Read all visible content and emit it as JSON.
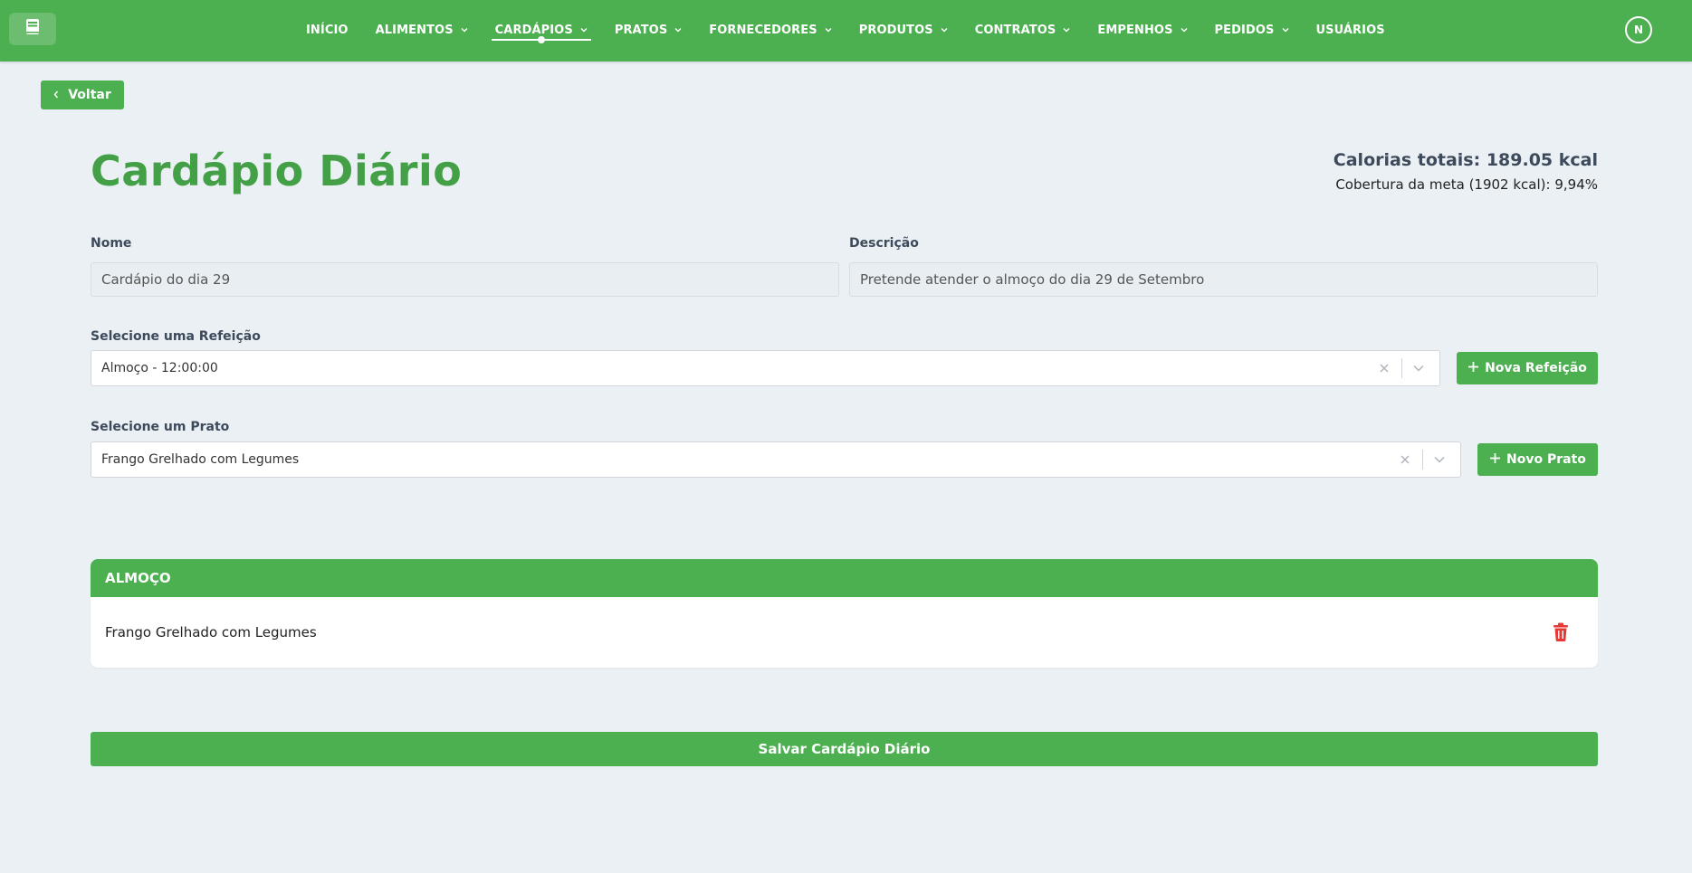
{
  "nav": {
    "items": [
      {
        "label": "INÍCIO",
        "dropdown": false,
        "active": false
      },
      {
        "label": "ALIMENTOS",
        "dropdown": true,
        "active": false
      },
      {
        "label": "CARDÁPIOS",
        "dropdown": true,
        "active": true
      },
      {
        "label": "PRATOS",
        "dropdown": true,
        "active": false
      },
      {
        "label": "FORNECEDORES",
        "dropdown": true,
        "active": false
      },
      {
        "label": "PRODUTOS",
        "dropdown": true,
        "active": false
      },
      {
        "label": "CONTRATOS",
        "dropdown": true,
        "active": false
      },
      {
        "label": "EMPENHOS",
        "dropdown": true,
        "active": false
      },
      {
        "label": "PEDIDOS",
        "dropdown": true,
        "active": false
      },
      {
        "label": "USUÁRIOS",
        "dropdown": false,
        "active": false
      }
    ],
    "avatar_initial": "N"
  },
  "back_label": "Voltar",
  "page": {
    "title": "Cardápio Diário",
    "calories_total": "Calorias totais: 189.05 kcal",
    "coverage": "Cobertura da meta (1902 kcal): 9,94%"
  },
  "form": {
    "name_label": "Nome",
    "name_value": "Cardápio do dia 29",
    "description_label": "Descrição",
    "description_value": "Pretende atender o almoço do dia 29 de Setembro",
    "meal_label": "Selecione uma Refeição",
    "meal_value": "Almoço - 12:00:00",
    "new_meal_label": "Nova Refeição",
    "dish_label": "Selecione um Prato",
    "dish_value": "Frango Grelhado com Legumes",
    "new_dish_label": "Novo Prato"
  },
  "meal_card": {
    "header": "ALMOÇO",
    "dish": "Frango Grelhado com Legumes"
  },
  "save_label": "Salvar Cardápio Diário",
  "colors": {
    "primary": "#4caf50",
    "title": "#43a047",
    "background": "#eaf0f4",
    "danger": "#e53935"
  },
  "icons": {
    "logo": "book-icon",
    "back": "chevron-left-icon",
    "clear": "close-icon",
    "dropdown": "chevron-down-icon",
    "add": "plus-icon",
    "delete": "trash-icon"
  }
}
